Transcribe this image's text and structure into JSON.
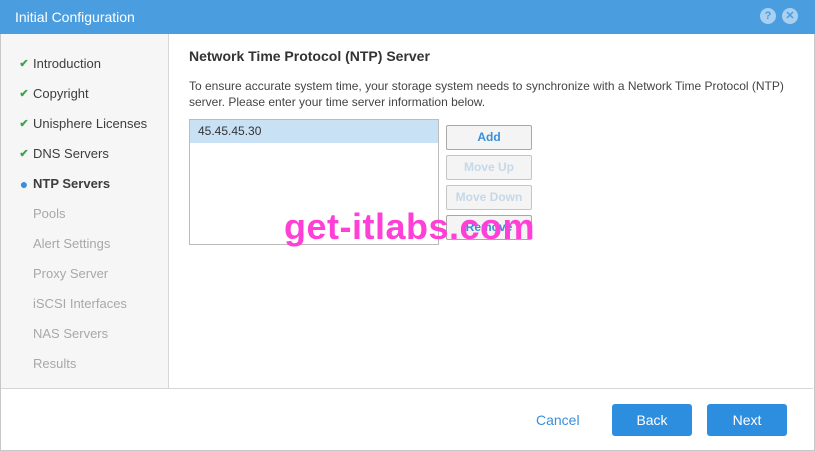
{
  "window": {
    "title": "Initial Configuration",
    "help_icon": "help-icon",
    "help_glyph": "?",
    "close_icon": "close-icon",
    "close_glyph": "✕"
  },
  "sidebar": {
    "steps": [
      {
        "label": "Introduction",
        "status": "done"
      },
      {
        "label": "Copyright",
        "status": "done"
      },
      {
        "label": "Unisphere Licenses",
        "status": "done"
      },
      {
        "label": "DNS Servers",
        "status": "done"
      },
      {
        "label": "NTP Servers",
        "status": "current"
      },
      {
        "label": "Pools",
        "status": "pending"
      },
      {
        "label": "Alert Settings",
        "status": "pending"
      },
      {
        "label": "Proxy Server",
        "status": "pending"
      },
      {
        "label": "iSCSI Interfaces",
        "status": "pending"
      },
      {
        "label": "NAS Servers",
        "status": "pending"
      },
      {
        "label": "Results",
        "status": "pending"
      }
    ],
    "done_marker": "✔",
    "current_marker": "●"
  },
  "main": {
    "title": "Network Time Protocol (NTP) Server",
    "description": "To ensure accurate system time, your storage system needs to synchronize with a Network Time Protocol (NTP) server. Please enter your time server information below.",
    "servers": [
      "45.45.45.30"
    ],
    "buttons": {
      "add": "Add",
      "move_up": "Move Up",
      "move_down": "Move Down",
      "remove": "Remove"
    }
  },
  "footer": {
    "cancel": "Cancel",
    "back": "Back",
    "next": "Next"
  },
  "watermark": "get-itlabs.com",
  "colors": {
    "accent": "#2d8ee0",
    "titlebar": "#4a9ee0",
    "done_check": "#3aa64c",
    "selection": "#c9e1f5",
    "watermark": "#ff3fd5"
  }
}
